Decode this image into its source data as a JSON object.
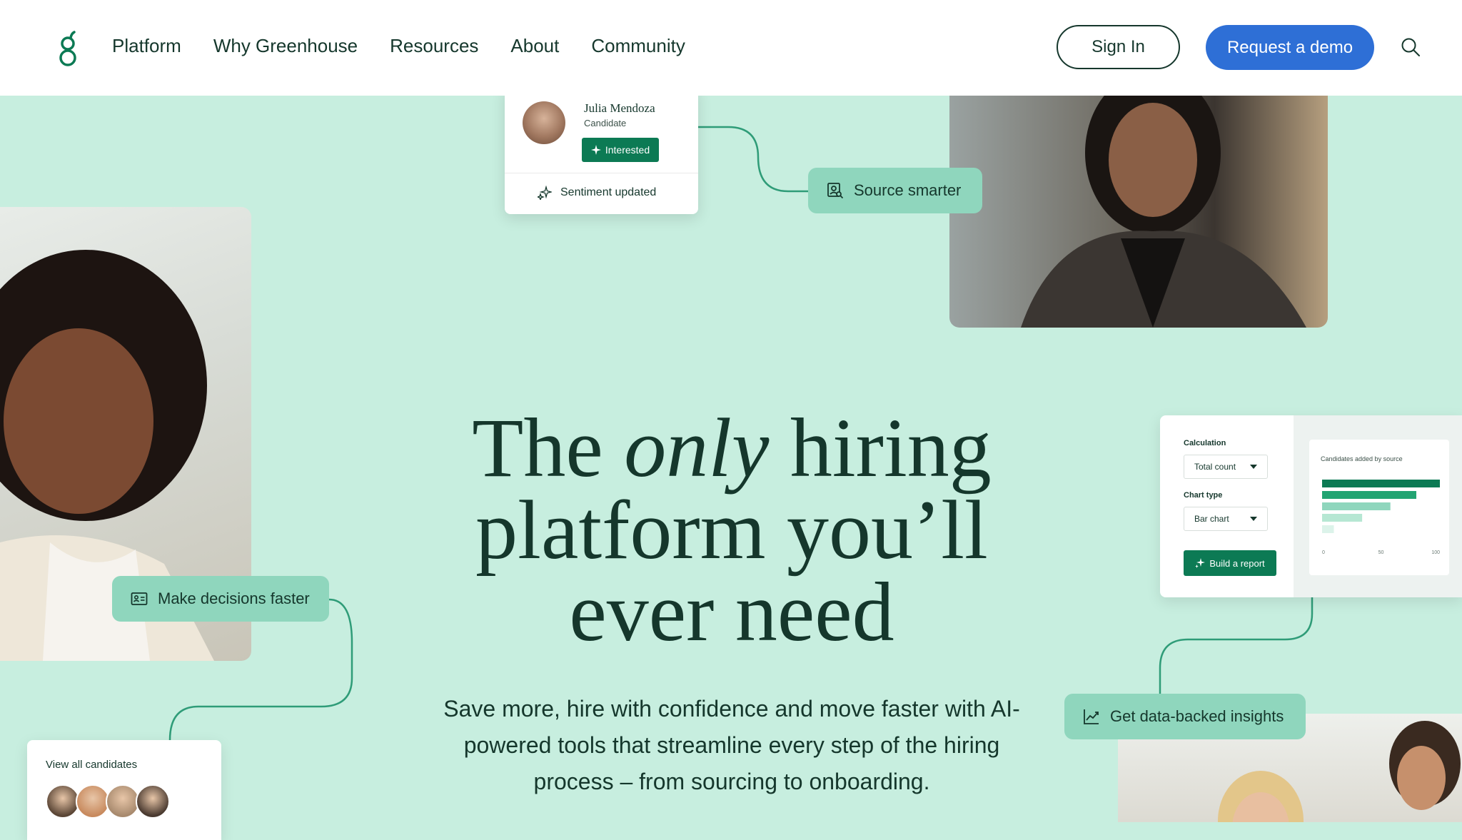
{
  "header": {
    "nav": [
      "Platform",
      "Why Greenhouse",
      "Resources",
      "About",
      "Community"
    ],
    "sign_in": "Sign In",
    "request_demo": "Request a demo"
  },
  "candidate_card": {
    "name": "Julia Mendoza",
    "role": "Candidate",
    "badge": "Interested",
    "footer": "Sentiment updated"
  },
  "tags": {
    "source": "Source smarter",
    "decisions": "Make decisions faster",
    "insights": "Get data-backed insights"
  },
  "hero": {
    "title_pre": "The ",
    "title_em": "only",
    "title_post": " hiring platform you’ll ever need",
    "subtitle": "Save more, hire with confidence and move faster with AI-powered tools that streamline every step of the hiring process – from sourcing to onboarding."
  },
  "report": {
    "calc_label": "Calculation",
    "calc_value": "Total count",
    "chart_type_label": "Chart type",
    "chart_type_value": "Bar chart",
    "button": "Build a report",
    "chart_data": {
      "type": "bar",
      "title": "Candidates added by source",
      "values": [
        100,
        80,
        58,
        34,
        10
      ],
      "colors": [
        "#0c7a54",
        "#22a472",
        "#8fd6bd",
        "#b6e7d3",
        "#dcf3ea"
      ],
      "xlim": [
        0,
        100
      ],
      "xticks": [
        "0",
        "50",
        "100"
      ]
    }
  },
  "candidates": {
    "title": "View all candidates",
    "avatar_colors": [
      "#5b4636",
      "#c88a5e",
      "#a88a6e",
      "#4a3a30"
    ]
  },
  "colors": {
    "background": "#c7eedf",
    "accent_green": "#0c7a54",
    "tag_green": "#8fd6bd",
    "button_blue": "#2e6fd6",
    "text_dark": "#15372c"
  }
}
